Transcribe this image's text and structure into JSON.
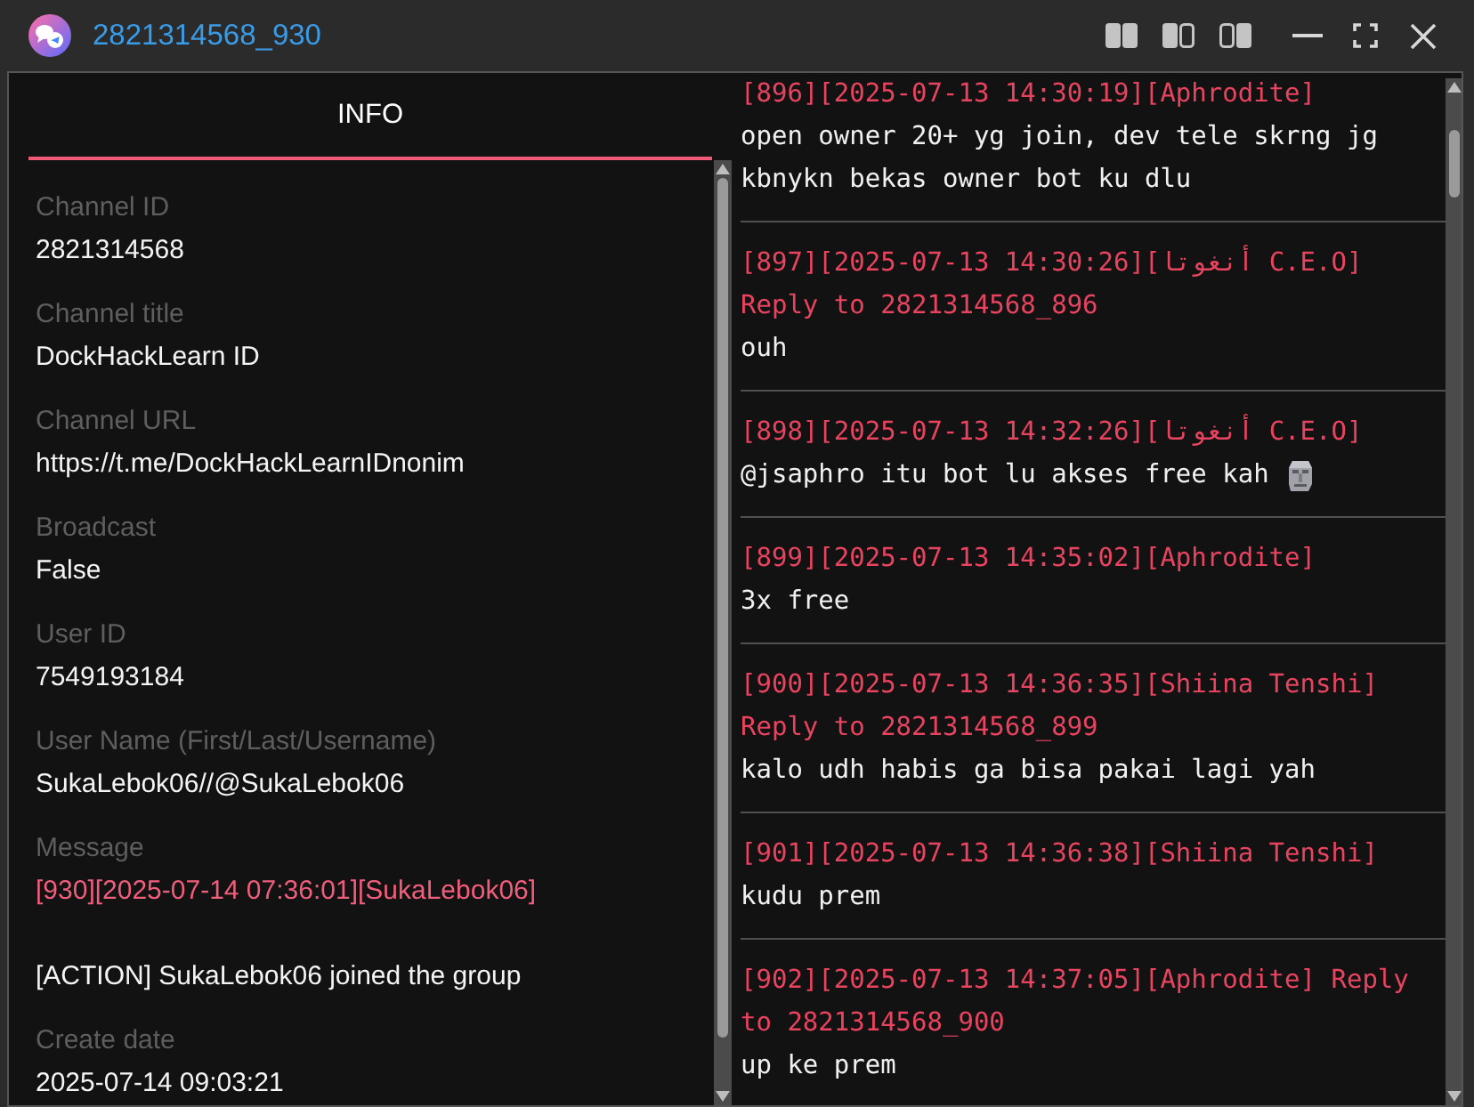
{
  "window": {
    "title": "2821314568_930"
  },
  "info_panel": {
    "tabs": [
      {
        "label": "INFO",
        "selected": true
      }
    ],
    "fields": [
      {
        "kind": "plain",
        "label": "Channel ID",
        "value": "2821314568"
      },
      {
        "kind": "plain",
        "label": "Channel title",
        "value": "DockHackLearn ID"
      },
      {
        "kind": "plain",
        "label": "Channel URL",
        "value": "https://t.me/DockHackLearnIDnonim"
      },
      {
        "kind": "plain",
        "label": "Broadcast",
        "value": "False"
      },
      {
        "kind": "plain",
        "label": "User ID",
        "value": "7549193184"
      },
      {
        "kind": "plain",
        "label": "User Name (First/Last/Username)",
        "value": "SukaLebok06//@SukaLebok06"
      },
      {
        "kind": "message",
        "label": "Message",
        "header": "[930][2025-07-14 07:36:01][SukaLebok06]",
        "body": "[ACTION] SukaLebok06 joined the group"
      },
      {
        "kind": "plain",
        "label": "Create date",
        "value": "2025-07-14 09:03:21"
      }
    ]
  },
  "messages": [
    {
      "header": "[896][2025-07-13 14:30:19][Aphrodite]",
      "text": "open owner 20+ yg join, dev tele skrng jg kbnykn bekas owner bot ku dlu",
      "has_emoji": false
    },
    {
      "header": "[897][2025-07-13 14:30:26][أنغوتا C.E.O]",
      "reply_to": "Reply to 2821314568_896",
      "text": "ouh",
      "has_emoji": false
    },
    {
      "header": "[898][2025-07-13 14:32:26][أنغوتا C.E.O]",
      "text": "@jsaphro itu bot lu akses free kah",
      "has_emoji": true
    },
    {
      "header": "[899][2025-07-13 14:35:02][Aphrodite]",
      "text": "3x free",
      "has_emoji": false
    },
    {
      "header": "[900][2025-07-13 14:36:35][Shiina Tenshi]",
      "reply_to": "Reply to 2821314568_899",
      "text": "kalo udh habis ga bisa pakai lagi yah",
      "has_emoji": false
    },
    {
      "header": "[901][2025-07-13 14:36:38][Shiina Tenshi]",
      "text": "kudu prem",
      "has_emoji": false
    },
    {
      "header": "[902][2025-07-13 14:37:05][Aphrodite]",
      "reply_to": "Reply to 2821314568_900",
      "text": "up ke prem",
      "has_emoji": false
    }
  ]
}
